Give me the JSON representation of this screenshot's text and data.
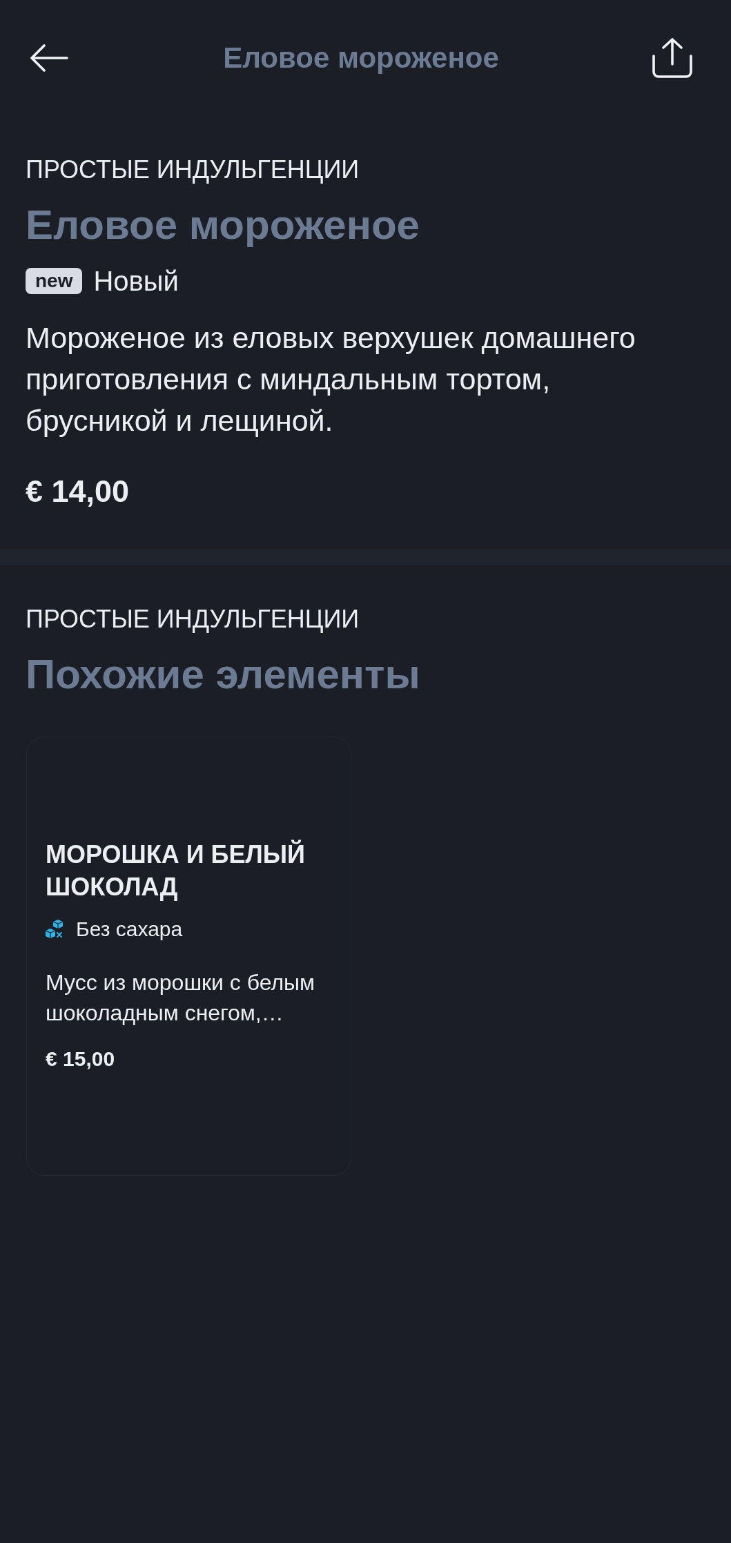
{
  "header": {
    "title": "Еловое мороженое"
  },
  "product": {
    "category": "ПРОСТЫЕ ИНДУЛЬГЕНЦИИ",
    "title": "Еловое мороженое",
    "status": {
      "badge": "new",
      "label": "Новый"
    },
    "description": "Мороженое из еловых верхушек домашнего приготовления с миндальным тортом, брусникой и лещиной.",
    "price": "€ 14,00"
  },
  "similar": {
    "category": "ПРОСТЫЕ ИНДУЛЬГЕНЦИИ",
    "title": "Похожие элементы",
    "items": [
      {
        "name": "МОРОШКА И БЕЛЫЙ ШОКОЛАД",
        "tags": [
          {
            "kind": "sugar_free",
            "label": "Без сахара"
          }
        ],
        "description": "Мусс из морошки с белым шоколадным снегом,…",
        "price": "€ 15,00"
      }
    ]
  }
}
